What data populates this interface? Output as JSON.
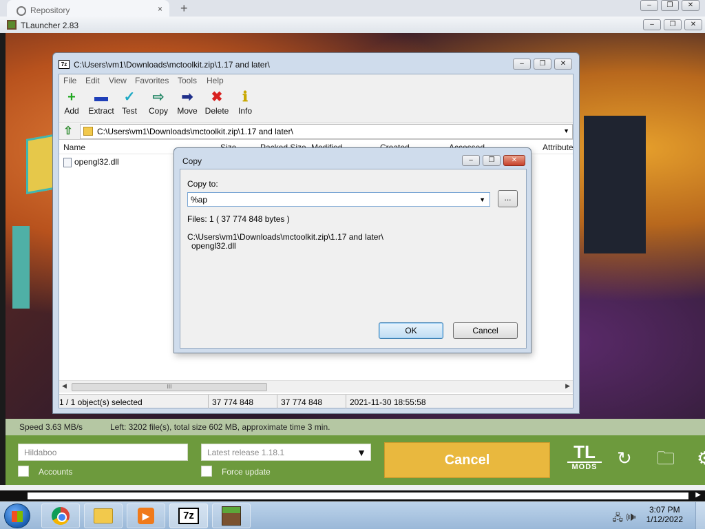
{
  "browser": {
    "tab_title": "Repository",
    "close_glyph": "×",
    "new_tab_glyph": "+"
  },
  "tlauncher": {
    "title": "TLauncher 2.83",
    "status": {
      "speed": "Speed 3.63 MB/s",
      "left": "Left: 3202 file(s), total size 602 MB, approximate time 3 min."
    },
    "username": "Hildaboo",
    "version_select": "Latest release 1.18.1",
    "accounts_label": "Accounts",
    "force_update_label": "Force update",
    "cancel_label": "Cancel",
    "tl_mods": {
      "line1": "TL",
      "line2": "MODS"
    },
    "icons": {
      "refresh": "↻",
      "folder": "🗀",
      "settings": "⚙"
    }
  },
  "sevenzip": {
    "title": "C:\\Users\\vm1\\Downloads\\mctoolkit.zip\\1.17 and later\\",
    "menu": [
      "File",
      "Edit",
      "View",
      "Favorites",
      "Tools",
      "Help"
    ],
    "toolbar": [
      {
        "label": "Add",
        "icon": "+",
        "color": "#1fa71f"
      },
      {
        "label": "Extract",
        "icon": "▬",
        "color": "#1f3fb8"
      },
      {
        "label": "Test",
        "icon": "✓",
        "color": "#1fa9c4"
      },
      {
        "label": "Copy",
        "icon": "⇨",
        "color": "#2a8a6a"
      },
      {
        "label": "Move",
        "icon": "➡",
        "color": "#1f2f8a"
      },
      {
        "label": "Delete",
        "icon": "✖",
        "color": "#d8201f"
      },
      {
        "label": "Info",
        "icon": "ℹ",
        "color": "#c9a800"
      }
    ],
    "address": "C:\\Users\\vm1\\Downloads\\mctoolkit.zip\\1.17 and later\\",
    "columns": [
      "Name",
      "Size",
      "Packed Size",
      "Modified",
      "Created",
      "Accessed",
      "Attribute"
    ],
    "files": [
      {
        "name": "opengl32.dll"
      }
    ],
    "scroll_grip": "III",
    "status": {
      "selected": "1 / 1 object(s) selected",
      "size": "37 774 848",
      "packed": "37 774 848",
      "modified": "2021-11-30 18:55:58"
    }
  },
  "dialog": {
    "title": "Copy",
    "copy_to_label": "Copy to:",
    "copy_to_value": "%ap",
    "browse_label": "...",
    "files_info": "Files: 1    ( 37 774 848 bytes )",
    "path_line1": "C:\\Users\\vm1\\Downloads\\mctoolkit.zip\\1.17 and later\\",
    "path_line2": "opengl32.dll",
    "ok_label": "OK",
    "cancel_label": "Cancel"
  },
  "taskbar": {
    "time": "3:07 PM",
    "date": "1/12/2022",
    "sevenzip_label": "7z",
    "media_glyph": "▶"
  }
}
